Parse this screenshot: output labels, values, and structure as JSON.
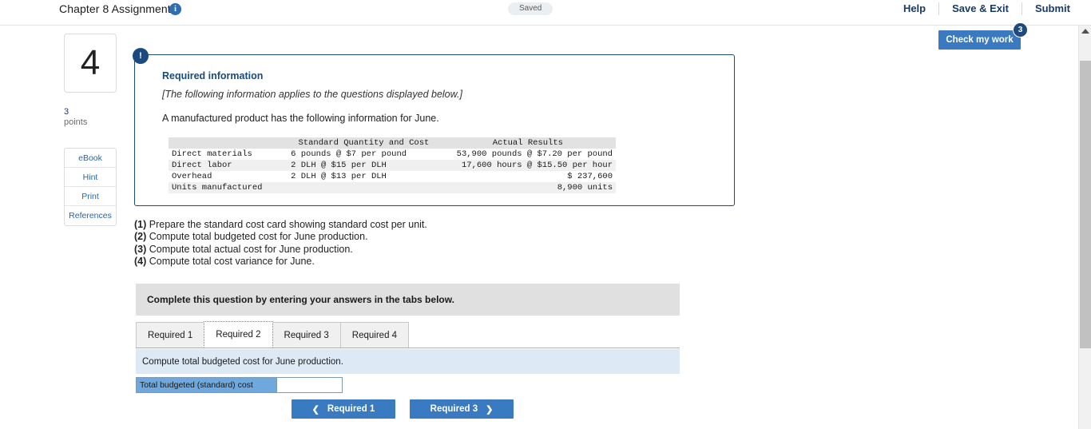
{
  "topbar": {
    "title": "Chapter 8 Assignment",
    "info_icon": "info-circle-icon",
    "saved_status": "Saved",
    "actions": [
      "Help",
      "Save & Exit",
      "Submit"
    ]
  },
  "check_my_work": {
    "label": "Check my work",
    "badge_count": "3"
  },
  "rail": {
    "question_number": "4",
    "points_value": "3",
    "points_label": "points",
    "resources": [
      "eBook",
      "Hint",
      "Print",
      "References"
    ]
  },
  "required_info": {
    "badge": "!",
    "title": "Required information",
    "italic_note": "[The following information applies to the questions displayed below.]",
    "lead": "A manufactured product has the following information for June."
  },
  "data_table": {
    "headers": [
      "",
      "Standard Quantity and Cost",
      "Actual Results"
    ],
    "rows": [
      {
        "label": "Direct materials",
        "standard": "6 pounds @ $7 per pound",
        "actual": "53,900 pounds @ $7.20 per pound"
      },
      {
        "label": "Direct labor",
        "standard": "2 DLH @ $15 per DLH",
        "actual": "17,600 hours @ $15.50 per hour"
      },
      {
        "label": "Overhead",
        "standard": "2 DLH @ $13 per DLH",
        "actual": "$ 237,600"
      },
      {
        "label": "Units manufactured",
        "standard": "",
        "actual": "8,900 units"
      }
    ]
  },
  "requirements": [
    {
      "num": "(1)",
      "text": "Prepare the standard cost card showing standard cost per unit."
    },
    {
      "num": "(2)",
      "text": "Compute total budgeted cost for June production."
    },
    {
      "num": "(3)",
      "text": "Compute total actual cost for June production."
    },
    {
      "num": "(4)",
      "text": "Compute total cost variance for June."
    }
  ],
  "complete_bar": {
    "text": "Complete this question by entering your answers in the tabs below."
  },
  "tabs": [
    {
      "label": "Required 1",
      "active": false
    },
    {
      "label": "Required 2",
      "active": true
    },
    {
      "label": "Required 3",
      "active": false
    },
    {
      "label": "Required 4",
      "active": false
    }
  ],
  "answer_panel": {
    "prompt": "Compute total budgeted cost for June production.",
    "row_label": "Total budgeted (standard) cost",
    "input_value": "",
    "input_placeholder": ""
  },
  "nav": {
    "prev_label": "Required 1",
    "prev_icon": "chevron-left-icon",
    "next_label": "Required 3",
    "next_icon": "chevron-right-icon"
  },
  "scrollbar": {
    "up_arrow": "triangle-up-icon"
  },
  "colors": {
    "accent_blue": "#3a7ac0",
    "dark_navy": "#1b4a7e",
    "label_blue": "#6fa8dc",
    "prompt_blue": "#ddeaf6",
    "grey_bar": "#e0e0e0"
  }
}
